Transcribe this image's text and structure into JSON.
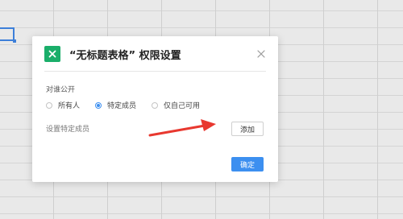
{
  "dialog": {
    "title": "“无标题表格” 权限设置",
    "section_label": "对谁公开",
    "radios": [
      {
        "label": "所有人",
        "checked": false
      },
      {
        "label": "特定成员",
        "checked": true
      },
      {
        "label": "仅自己可用",
        "checked": false
      }
    ],
    "specific_members_label": "设置特定成员",
    "add_button": "添加",
    "ok_button": "确定"
  },
  "colors": {
    "accent": "#3c8ff0",
    "app_icon_green": "#1aae6a",
    "annotation_arrow": "#e8382f"
  },
  "icons": {
    "app": "spreadsheet-x-icon",
    "close": "close-icon"
  }
}
